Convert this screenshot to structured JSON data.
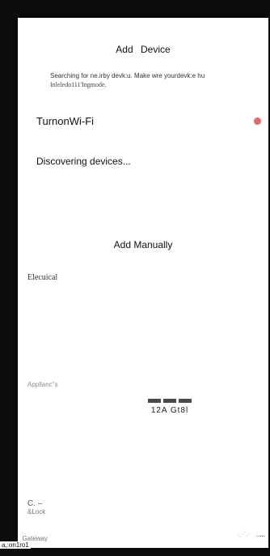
{
  "status_bar": {
    "dots": "····"
  },
  "header": {
    "title_prefix": "Add",
    "title": "Device"
  },
  "hint": {
    "line1": "Searching for ne.irby devk:u. Make wre  yourdevk:e hu",
    "line2": "Inleledo111'Ingmode."
  },
  "wifi": {
    "label": "TurnonWi-Fi",
    "status_color": "#e06a6a"
  },
  "discover": {
    "label": "Discovering devices..."
  },
  "manual": {
    "label": "Add Manually"
  },
  "categories": {
    "electrical": "Elecuical",
    "appliances": "Appllanc\"s",
    "lock_symbol": "C.  –",
    "lock": "&Lock",
    "gateway": "_Gateway",
    "gateway_sub": "a,:on1ro1"
  },
  "device_tile": {
    "label": "12A Gt8l"
  },
  "bottom": {
    "faint": "·.·`.·",
    "strong": "....."
  }
}
